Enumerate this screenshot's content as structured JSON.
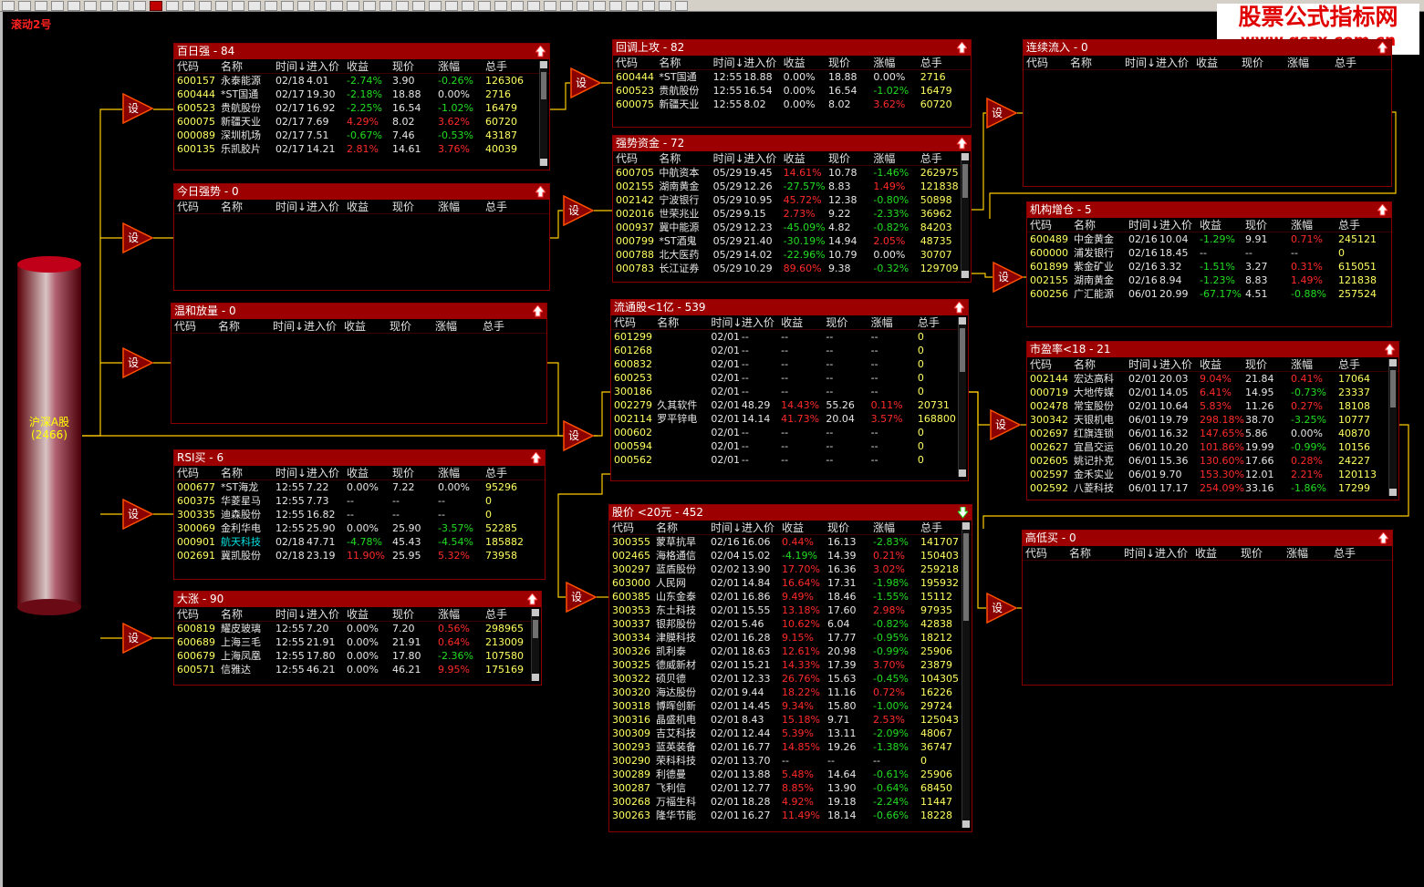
{
  "app": {
    "scroll_label": "滚动2号",
    "watermark_line1": "股票公式指标网",
    "watermark_line2": "www.gszx.com.cn"
  },
  "root": {
    "name": "沪深A股",
    "count": "(2466)"
  },
  "set_label": "设",
  "colors": {
    "title_bar": "#9c0000",
    "border": "#8a0000",
    "connector": "#ffcc00",
    "up": "#ff2a2a",
    "down": "#22dd22"
  },
  "headers": [
    "代码",
    "名称",
    "时间↓",
    "进入价",
    "收益",
    "现价",
    "涨幅",
    "总手"
  ],
  "panels": [
    {
      "id": "p1",
      "title": "百日强 - 84",
      "arrow": "up",
      "rows": [
        [
          "600157",
          "永泰能源",
          "02/18",
          "4.01",
          "-2.74%",
          "3.90",
          "-0.26%",
          "126306"
        ],
        [
          "600444",
          "*ST国通",
          "02/17",
          "19.30",
          "-2.18%",
          "18.88",
          "0.00%",
          "2716"
        ],
        [
          "600523",
          "贵航股份",
          "02/17",
          "16.92",
          "-2.25%",
          "16.54",
          "-1.02%",
          "16479"
        ],
        [
          "600075",
          "新疆天业",
          "02/17",
          "7.69",
          "4.29%",
          "8.02",
          "3.62%",
          "60720"
        ],
        [
          "000089",
          "深圳机场",
          "02/17",
          "7.51",
          "-0.67%",
          "7.46",
          "-0.53%",
          "43187"
        ],
        [
          "600135",
          "乐凯胶片",
          "02/17",
          "14.21",
          "2.81%",
          "14.61",
          "3.76%",
          "40039"
        ]
      ]
    },
    {
      "id": "p2",
      "title": "今日强势 - 0",
      "arrow": "up",
      "rows": []
    },
    {
      "id": "p3",
      "title": "温和放量 - 0",
      "arrow": "up",
      "rows": []
    },
    {
      "id": "p4",
      "title": "RSI买 - 6",
      "arrow": "up",
      "rows": [
        [
          "000677",
          "*ST海龙",
          "12:55",
          "7.22",
          "0.00%",
          "7.22",
          "0.00%",
          "95296"
        ],
        [
          "600375",
          "华菱星马",
          "12:55",
          "7.73",
          "--",
          "--",
          "--",
          "0"
        ],
        [
          "300335",
          "迪森股份",
          "12:55",
          "16.82",
          "--",
          "--",
          "--",
          "0"
        ],
        [
          "300069",
          "金利华电",
          "12:55",
          "25.90",
          "0.00%",
          "25.90",
          "-3.57%",
          "52285"
        ],
        [
          "000901",
          "航天科技",
          "02/18",
          "47.71",
          "-4.78%",
          "45.43",
          "-4.54%",
          "185882"
        ],
        [
          "002691",
          "冀凯股份",
          "02/18",
          "23.19",
          "11.90%",
          "25.95",
          "5.32%",
          "73958"
        ]
      ]
    },
    {
      "id": "p5",
      "title": "大涨 - 90",
      "arrow": "up",
      "rows": [
        [
          "600819",
          "耀皮玻璃",
          "12:55",
          "7.20",
          "0.00%",
          "7.20",
          "0.56%",
          "298965"
        ],
        [
          "600689",
          "上海三毛",
          "12:55",
          "21.91",
          "0.00%",
          "21.91",
          "0.64%",
          "213009"
        ],
        [
          "600679",
          "上海凤凰",
          "12:55",
          "17.80",
          "0.00%",
          "17.80",
          "-2.36%",
          "107580"
        ],
        [
          "600571",
          "信雅达",
          "12:55",
          "46.21",
          "0.00%",
          "46.21",
          "9.95%",
          "175169"
        ]
      ]
    },
    {
      "id": "p6",
      "title": "回调上攻 - 82",
      "arrow": "up",
      "rows": [
        [
          "600444",
          "*ST国通",
          "12:55",
          "18.88",
          "0.00%",
          "18.88",
          "0.00%",
          "2716"
        ],
        [
          "600523",
          "贵航股份",
          "12:55",
          "16.54",
          "0.00%",
          "16.54",
          "-1.02%",
          "16479"
        ],
        [
          "600075",
          "新疆天业",
          "12:55",
          "8.02",
          "0.00%",
          "8.02",
          "3.62%",
          "60720"
        ]
      ]
    },
    {
      "id": "p7",
      "title": "强势资金 - 72",
      "arrow": "up",
      "rows": [
        [
          "600705",
          "中航资本",
          "05/29",
          "19.45",
          "14.61%",
          "10.78",
          "-1.46%",
          "262975"
        ],
        [
          "002155",
          "湖南黄金",
          "05/29",
          "12.26",
          "-27.57%",
          "8.83",
          "1.49%",
          "121838"
        ],
        [
          "002142",
          "宁波银行",
          "05/29",
          "10.95",
          "45.72%",
          "12.38",
          "-0.80%",
          "50898"
        ],
        [
          "002016",
          "世荣兆业",
          "05/29",
          "9.15",
          "2.73%",
          "9.22",
          "-2.33%",
          "36962"
        ],
        [
          "000937",
          "冀中能源",
          "05/29",
          "12.23",
          "-45.09%",
          "4.82",
          "-0.82%",
          "84203"
        ],
        [
          "000799",
          "*ST酒鬼",
          "05/29",
          "21.40",
          "-30.19%",
          "14.94",
          "2.05%",
          "48735"
        ],
        [
          "000788",
          "北大医药",
          "05/29",
          "14.02",
          "-22.96%",
          "10.79",
          "0.00%",
          "30707"
        ],
        [
          "000783",
          "长江证券",
          "05/29",
          "10.29",
          "89.60%",
          "9.38",
          "-0.32%",
          "129709"
        ]
      ]
    },
    {
      "id": "p8",
      "title": "流通股<1亿 - 539",
      "arrow": "up",
      "rows": [
        [
          "601299",
          "",
          "02/01",
          "--",
          "--",
          "--",
          "--",
          "0"
        ],
        [
          "601268",
          "",
          "02/01",
          "--",
          "--",
          "--",
          "--",
          "0"
        ],
        [
          "600832",
          "",
          "02/01",
          "--",
          "--",
          "--",
          "--",
          "0"
        ],
        [
          "600253",
          "",
          "02/01",
          "--",
          "--",
          "--",
          "--",
          "0"
        ],
        [
          "300186",
          "",
          "02/01",
          "--",
          "--",
          "--",
          "--",
          "0"
        ],
        [
          "002279",
          "久其软件",
          "02/01",
          "48.29",
          "14.43%",
          "55.26",
          "0.11%",
          "20731"
        ],
        [
          "002114",
          "罗平锌电",
          "02/01",
          "14.14",
          "41.73%",
          "20.04",
          "3.57%",
          "168800"
        ],
        [
          "000602",
          "",
          "02/01",
          "--",
          "--",
          "--",
          "--",
          "0"
        ],
        [
          "000594",
          "",
          "02/01",
          "--",
          "--",
          "--",
          "--",
          "0"
        ],
        [
          "000562",
          "",
          "02/01",
          "--",
          "--",
          "--",
          "--",
          "0"
        ]
      ]
    },
    {
      "id": "p9",
      "title": "股价 <20元 - 452",
      "arrow": "down",
      "rows": [
        [
          "300355",
          "蒙草抗旱",
          "02/16",
          "16.06",
          "0.44%",
          "16.13",
          "-2.83%",
          "141707"
        ],
        [
          "002465",
          "海格通信",
          "02/04",
          "15.02",
          "-4.19%",
          "14.39",
          "0.21%",
          "150403"
        ],
        [
          "300297",
          "蓝盾股份",
          "02/02",
          "13.90",
          "17.70%",
          "16.36",
          "3.02%",
          "259218"
        ],
        [
          "603000",
          "人民网",
          "02/01",
          "14.84",
          "16.64%",
          "17.31",
          "-1.98%",
          "195932"
        ],
        [
          "600385",
          "山东金泰",
          "02/01",
          "16.86",
          "9.49%",
          "18.46",
          "-1.55%",
          "15112"
        ],
        [
          "300353",
          "东土科技",
          "02/01",
          "15.55",
          "13.18%",
          "17.60",
          "2.98%",
          "97935"
        ],
        [
          "300337",
          "银邦股份",
          "02/01",
          "5.46",
          "10.62%",
          "6.04",
          "-0.82%",
          "42838"
        ],
        [
          "300334",
          "津膜科技",
          "02/01",
          "16.28",
          "9.15%",
          "17.77",
          "-0.95%",
          "18212"
        ],
        [
          "300326",
          "凯利泰",
          "02/01",
          "18.63",
          "12.61%",
          "20.98",
          "-0.99%",
          "25906"
        ],
        [
          "300325",
          "德威新材",
          "02/01",
          "15.21",
          "14.33%",
          "17.39",
          "3.70%",
          "23879"
        ],
        [
          "300322",
          "硕贝德",
          "02/01",
          "12.33",
          "26.76%",
          "15.63",
          "-0.45%",
          "104305"
        ],
        [
          "300320",
          "海达股份",
          "02/01",
          "9.44",
          "18.22%",
          "11.16",
          "0.72%",
          "16226"
        ],
        [
          "300318",
          "博晖创新",
          "02/01",
          "14.45",
          "9.34%",
          "15.80",
          "-1.00%",
          "29724"
        ],
        [
          "300316",
          "晶盛机电",
          "02/01",
          "8.43",
          "15.18%",
          "9.71",
          "2.53%",
          "125043"
        ],
        [
          "300309",
          "吉艾科技",
          "02/01",
          "12.44",
          "5.39%",
          "13.11",
          "-2.09%",
          "48067"
        ],
        [
          "300293",
          "蓝英装备",
          "02/01",
          "16.77",
          "14.85%",
          "19.26",
          "-1.38%",
          "36747"
        ],
        [
          "300290",
          "荣科科技",
          "02/01",
          "13.70",
          "--",
          "--",
          "--",
          "0"
        ],
        [
          "300289",
          "利德曼",
          "02/01",
          "13.88",
          "5.48%",
          "14.64",
          "-0.61%",
          "25906"
        ],
        [
          "300287",
          "飞利信",
          "02/01",
          "12.77",
          "8.85%",
          "13.90",
          "-0.64%",
          "68450"
        ],
        [
          "300268",
          "万福生科",
          "02/01",
          "18.28",
          "4.92%",
          "19.18",
          "-2.24%",
          "11447"
        ],
        [
          "300263",
          "隆华节能",
          "02/01",
          "16.27",
          "11.49%",
          "18.14",
          "-0.66%",
          "18228"
        ]
      ]
    },
    {
      "id": "p10",
      "title": "连续流入 - 0",
      "arrow": "up",
      "rows": []
    },
    {
      "id": "p11",
      "title": "机构增仓 - 5",
      "arrow": "up",
      "rows": [
        [
          "600489",
          "中金黄金",
          "02/16",
          "10.04",
          "-1.29%",
          "9.91",
          "0.71%",
          "245121"
        ],
        [
          "600000",
          "浦发银行",
          "02/16",
          "18.45",
          "--",
          "--",
          "--",
          "0"
        ],
        [
          "601899",
          "紫金矿业",
          "02/16",
          "3.32",
          "-1.51%",
          "3.27",
          "0.31%",
          "615051"
        ],
        [
          "002155",
          "湖南黄金",
          "02/16",
          "8.94",
          "-1.23%",
          "8.83",
          "1.49%",
          "121838"
        ],
        [
          "600256",
          "广汇能源",
          "06/01",
          "20.99",
          "-67.17%",
          "4.51",
          "-0.88%",
          "257524"
        ]
      ]
    },
    {
      "id": "p12",
      "title": "市盈率<18 - 21",
      "arrow": "up",
      "rows": [
        [
          "002144",
          "宏达高科",
          "02/01",
          "20.03",
          "9.04%",
          "21.84",
          "0.41%",
          "17064"
        ],
        [
          "000719",
          "大地传媒",
          "02/01",
          "14.05",
          "6.41%",
          "14.95",
          "-0.73%",
          "23337"
        ],
        [
          "002478",
          "常宝股份",
          "02/01",
          "10.64",
          "5.83%",
          "11.26",
          "0.27%",
          "18108"
        ],
        [
          "300342",
          "天银机电",
          "06/01",
          "19.79",
          "298.18%",
          "38.70",
          "-3.25%",
          "10777"
        ],
        [
          "002697",
          "红旗连锁",
          "06/01",
          "16.32",
          "147.65%",
          "5.86",
          "0.00%",
          "40870"
        ],
        [
          "002627",
          "宜昌交运",
          "06/01",
          "10.20",
          "101.86%",
          "19.99",
          "-0.99%",
          "10156"
        ],
        [
          "002605",
          "姚记扑克",
          "06/01",
          "15.36",
          "130.60%",
          "17.66",
          "0.28%",
          "24227"
        ],
        [
          "002597",
          "金禾实业",
          "06/01",
          "9.70",
          "153.30%",
          "12.01",
          "2.21%",
          "120113"
        ],
        [
          "002592",
          "八菱科技",
          "06/01",
          "17.17",
          "254.09%",
          "33.16",
          "-1.86%",
          "17299"
        ]
      ]
    },
    {
      "id": "p13",
      "title": "高低买 - 0",
      "arrow": "up",
      "rows": []
    }
  ]
}
